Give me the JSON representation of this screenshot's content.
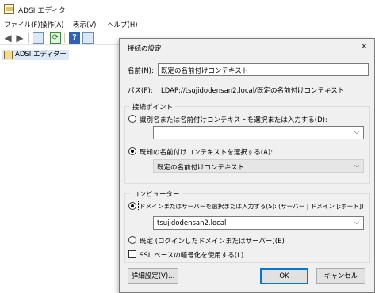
{
  "app": {
    "title": "ADSI エディター",
    "menu": [
      "ファイル(F)",
      "操作(A)",
      "表示(V)",
      "ヘルプ(H)"
    ],
    "toolbar_icons": [
      "back-arrow-icon",
      "forward-arrow-icon",
      "show-tree-icon",
      "refresh-icon",
      "help-icon",
      "properties-icon"
    ],
    "tree": {
      "root_label": "ADSI エディター"
    }
  },
  "dialog": {
    "title": "接続の設定",
    "close_glyph": "✕",
    "name_label": "名前(N):",
    "name_value": "既定の名前付けコンテキスト",
    "path_label": "パス(P):",
    "path_value": "LDAP://tsujidodensan2.local/既定の名前付けコンテキスト",
    "connection_point": {
      "title": "接続ポイント",
      "option_dn": "識別名または名前付けコンテキストを選択または入力する(D):",
      "option_dn_value": "",
      "option_known": "既知の名前付けコンテキストを選択する(A):",
      "known_value": "既定の名前付けコンテキスト",
      "selected": "known"
    },
    "computer": {
      "title": "コンピューター",
      "option_server": "ドメインまたはサーバーを選択または入力する(S): (サーバー | ドメイン [:ポート])",
      "server_value": "tsujidodensan2.local",
      "option_default": "既定 (ログインしたドメインまたはサーバー)(E)",
      "ssl_label": "SSL ベースの暗号化を使用する(L)",
      "ssl_checked": false,
      "selected": "server"
    },
    "buttons": {
      "advanced": "詳細設定(V)...",
      "ok": "OK",
      "cancel": "キャンセル"
    },
    "chevron_glyph": "⌵"
  }
}
